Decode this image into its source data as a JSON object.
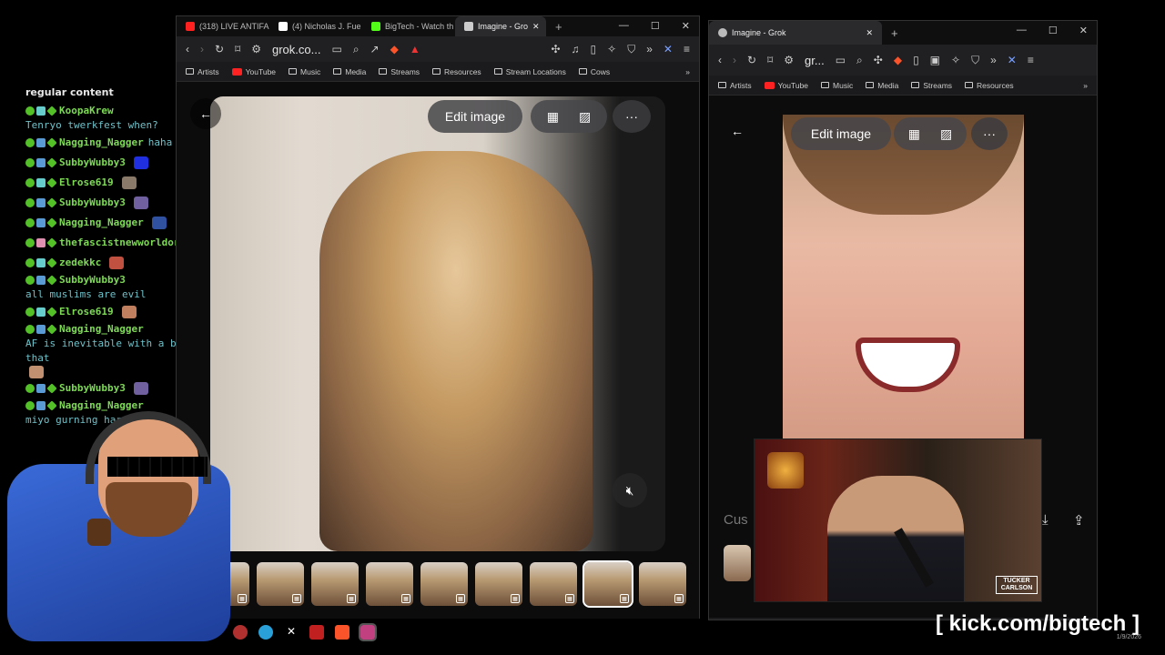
{
  "chat": {
    "title": "regular content",
    "messages": [
      {
        "user": "KoopaKrew",
        "text": "Tenryo twerkfest when?",
        "color": "#7ed957",
        "badge_color": "#66cccc",
        "emote_color": ""
      },
      {
        "user": "Nagging_Nagger",
        "text": "haha",
        "color": "#7ed957",
        "badge_color": "#5a9bd5",
        "emote_color": ""
      },
      {
        "user": "SubbyWubby3",
        "text": "",
        "color": "#7ed957",
        "badge_color": "#5a9bd5",
        "emote_color": "#2030e0"
      },
      {
        "user": "Elrose619",
        "text": "",
        "color": "#7ed957",
        "badge_color": "#66cccc",
        "emote_color": "#8a7a6a"
      },
      {
        "user": "SubbyWubby3",
        "text": "",
        "color": "#7ed957",
        "badge_color": "#5a9bd5",
        "emote_color": "#7060a0"
      },
      {
        "user": "Nagging_Nagger",
        "text": "",
        "color": "#7ed957",
        "badge_color": "#5a9bd5",
        "emote_color": "#3050a0"
      },
      {
        "user": "thefascistnewworldorder",
        "text": "",
        "color": "#7ed957",
        "badge_color": "#e090b0",
        "emote_color": "#c0c040"
      },
      {
        "user": "zedekkc",
        "text": "",
        "color": "#7ed957",
        "badge_color": "#66cccc",
        "emote_color": "#c05040"
      },
      {
        "user": "SubbyWubby3",
        "text": "all muslims are evil",
        "color": "#7ed957",
        "badge_color": "#5a9bd5",
        "emote_color": ""
      },
      {
        "user": "Elrose619",
        "text": "",
        "color": "#7ed957",
        "badge_color": "#66cccc",
        "emote_color": "#c08060"
      },
      {
        "user": "Nagging_Nagger",
        "text": "AF is inevitable with a body like that",
        "color": "#7ed957",
        "badge_color": "#5a9bd5",
        "emote_color": "#c09070"
      },
      {
        "user": "SubbyWubby3",
        "text": "",
        "color": "#7ed957",
        "badge_color": "#5a9bd5",
        "emote_color": "#7060a0"
      },
      {
        "user": "Nagging_Nagger",
        "text": "miyo gurning hard",
        "color": "#7ed957",
        "badge_color": "#5a9bd5",
        "emote_color": ""
      }
    ]
  },
  "left_browser": {
    "tabs": [
      {
        "label": "(318) LIVE ANTIFA",
        "icon": "youtube-icon",
        "color": "#ff2020"
      },
      {
        "label": "(4) Nicholas J. Fue",
        "icon": "x-icon",
        "color": "#ffffff"
      },
      {
        "label": "BigTech - Watch th",
        "icon": "kick-icon",
        "color": "#53fc18"
      },
      {
        "label": "Imagine - Gro",
        "icon": "grok-icon",
        "color": "#cccccc"
      }
    ],
    "url": "grok.co...",
    "bookmarks": [
      "Artists",
      "YouTube",
      "Music",
      "Media",
      "Streams",
      "Resources",
      "Stream Locations",
      "Cows"
    ],
    "edit_label": "Edit image",
    "more_label": "···"
  },
  "right_browser": {
    "tab_label": "Imagine - Grok",
    "url": "gr...",
    "bookmarks": [
      "Artists",
      "YouTube",
      "Music",
      "Media",
      "Streams",
      "Resources"
    ],
    "edit_label": "Edit image",
    "more_label": "···",
    "prompt_placeholder": "Cus"
  },
  "webcam_overlay": {
    "logo": "TUCKER CARLSON"
  },
  "footer": {
    "url": "[ kick.com/bigtech ]",
    "date": "1/9/2026"
  }
}
